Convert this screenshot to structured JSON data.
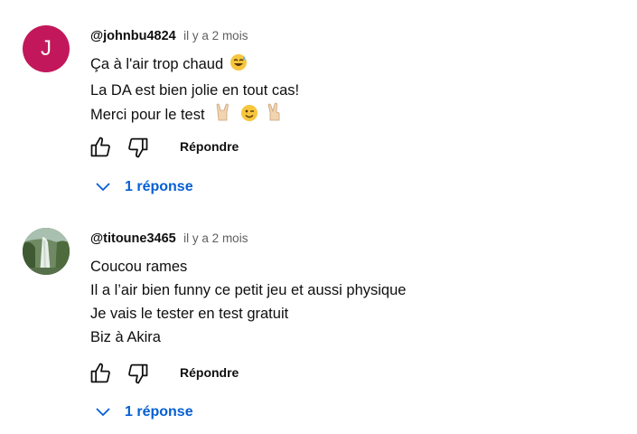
{
  "comments": [
    {
      "author": "@johnbu4824",
      "time": "il y a 2 mois",
      "avatar_letter": "J",
      "avatar_color": "#c2185b",
      "lines": [
        "Ça à l'air trop chaud",
        "La DA est bien jolie en tout cas!",
        "Merci pour le test"
      ],
      "emojis": [
        "sweat-smile-emoji",
        "rock-hand-emoji",
        "wink-emoji",
        "victory-hand-emoji"
      ],
      "reply_label": "Répondre",
      "replies_label": "1 réponse"
    },
    {
      "author": "@titoune3465",
      "time": "il y a 2 mois",
      "avatar_image": "waterfall-photo",
      "lines": [
        "Coucou rames",
        "Il a l’air bien funny ce petit jeu et aussi physique",
        "Je vais le tester en test gratuit",
        "Biz à Akira"
      ],
      "reply_label": "Répondre",
      "replies_label": "1 réponse"
    }
  ],
  "colors": {
    "link": "#065fd4",
    "secondary_text": "#606060"
  }
}
